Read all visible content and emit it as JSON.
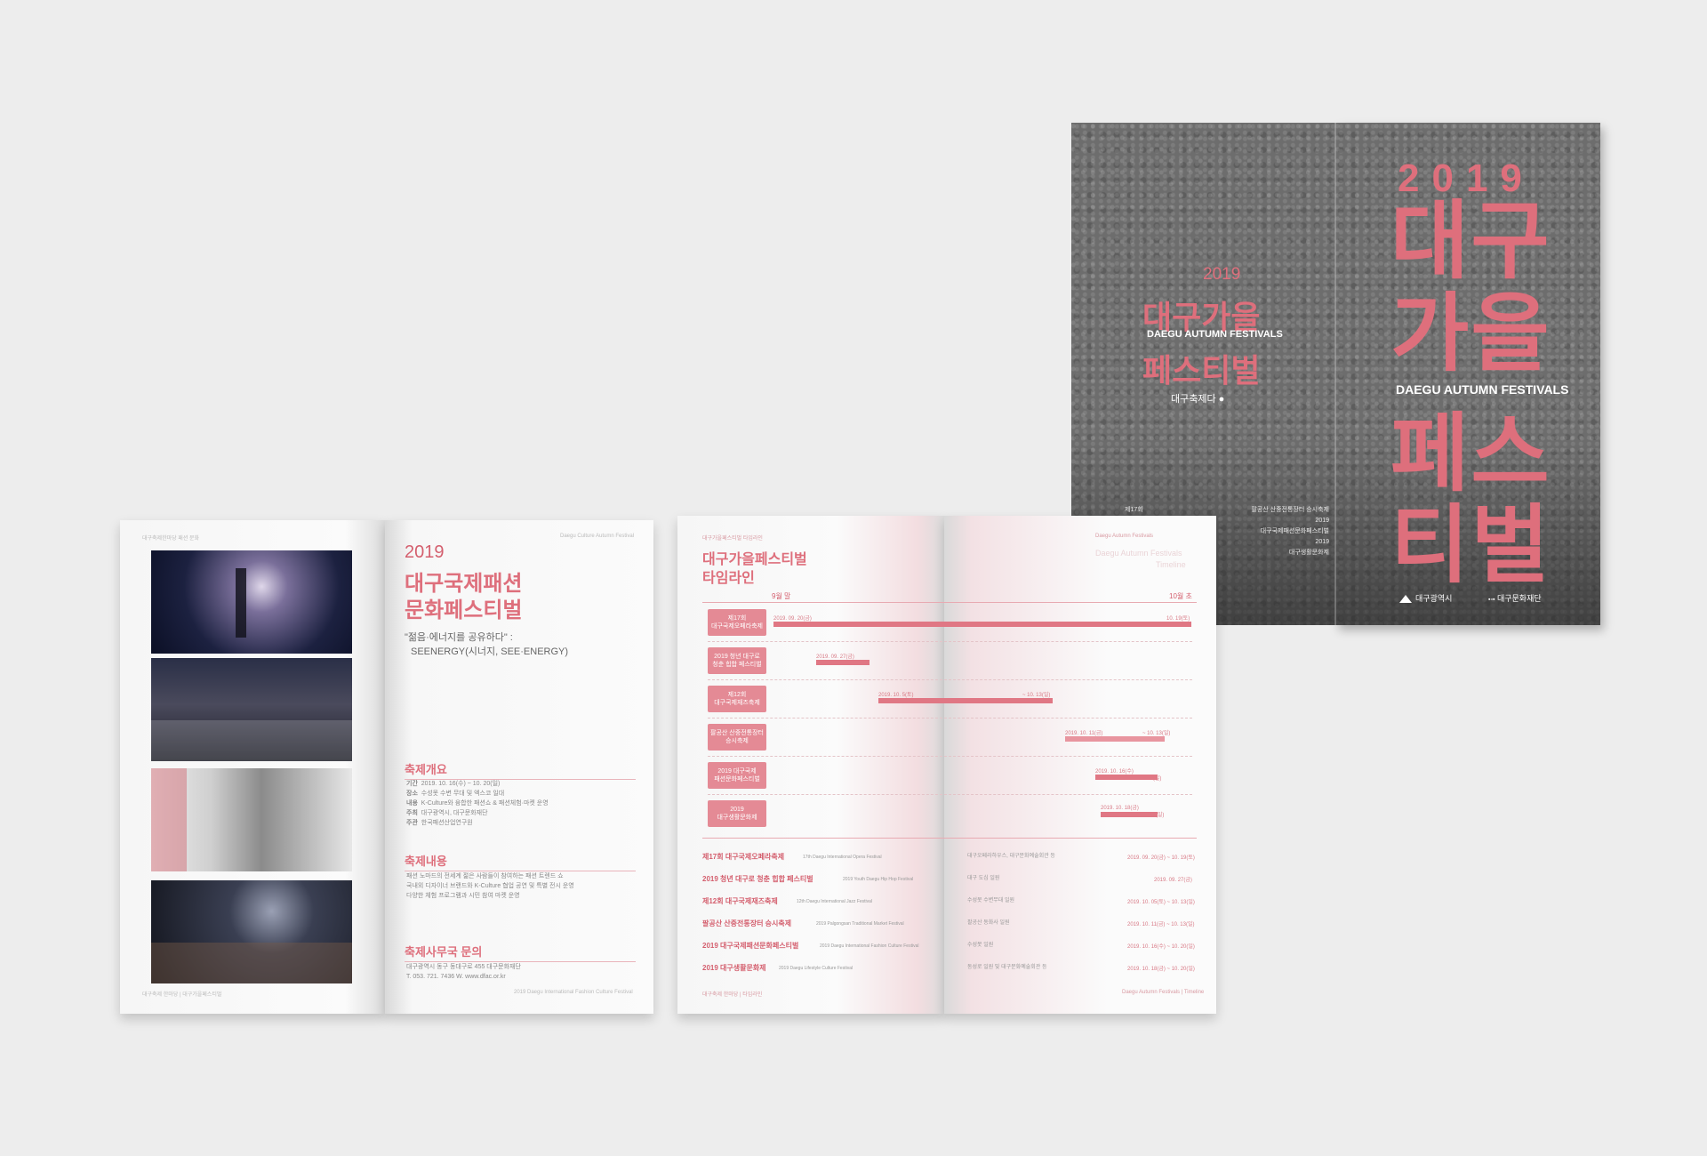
{
  "cover": {
    "front": {
      "year": "2019",
      "title_lines": [
        "대구",
        "가을",
        "페스",
        "티벌"
      ],
      "subtitle": "DAEGU AUTUMN FESTIVALS",
      "logo_city": "대구광역시",
      "logo_foundation": "대구문화재단"
    },
    "back": {
      "year": "2019",
      "title_line1": "대구가을",
      "title_line2": "페스티벌",
      "subtitle": "DAEGU AUTUMN FESTIVALS",
      "org": "대구축제다 ●",
      "list": [
        "제17회",
        "팔공산 산중전통장터 승시축제",
        "2019",
        "대구국제패션문화페스티벌",
        "2019",
        "대구생활문화제"
      ]
    }
  },
  "booklet1": {
    "left_header": "대구축제한마당 패션 문화",
    "right_header": "Daegu Culture Autumn Festival",
    "year": "2019",
    "title_line1": "대구국제패션",
    "title_line2": "문화페스티벌",
    "slogan": "\"젊음·에너지를 공유하다\" :",
    "slogan2": "SEENERGY(시너지, SEE·ENERGY)",
    "overview_title": "축제개요",
    "overview": [
      {
        "k": "기간",
        "v": "2019. 10. 16(수) ~ 10. 20(일)"
      },
      {
        "k": "장소",
        "v": "수성못 수변 무대 및 엑스코 일대"
      },
      {
        "k": "내용",
        "v": "K-Culture와 융합한 패션쇼 & 패션체험·마켓 운영"
      },
      {
        "k": "주최",
        "v": "대구광역시, 대구문화재단"
      },
      {
        "k": "주관",
        "v": "한국패션산업연구원"
      }
    ],
    "content_title": "축제내용",
    "content_lines": [
      "패션 노마드의 전세계 젊은 사람들이 참여하는 패션 트렌드 쇼",
      "국내외 디자이너 브랜드와 K-Culture 협업 공연 및 특별 전시 운영",
      "다양한 체험 프로그램과 시민 참여 마켓 운영"
    ],
    "office_title": "축제사무국 문의",
    "office_lines": [
      "대구광역시 동구 동대구로 455 대구문화재단",
      "T. 053. 721. 7436   W. www.dfac.or.kr"
    ],
    "footer_left": "대구축제 한마당 | 대구가을페스티벌",
    "footer_right": "2019 Daegu International Fashion Culture Festival"
  },
  "booklet2": {
    "left_header": "대구가을페스티벌 타임라인",
    "right_header": "Daegu Autumn Festivals",
    "title_line1": "대구가을페스티벌",
    "title_line2": "타임라인",
    "subtitle_en1": "Daegu Autumn Festivals",
    "subtitle_en2": "Timeline",
    "month_start": "9월 말",
    "month_end": "10월 초",
    "events": [
      {
        "label1": "제17회",
        "label2": "대구국제오페라축제",
        "date_start": "2019. 09. 20(금)",
        "date_end": "10. 19(토)"
      },
      {
        "label1": "2019 청년 대구로",
        "label2": "청춘 힙합 페스티벌",
        "date_start": "2019. 09. 27(금)",
        "date_end": ""
      },
      {
        "label1": "제12회",
        "label2": "대구국제재즈축제",
        "date_start": "2019. 10. 5(토)",
        "date_end": "~ 10. 13(일)"
      },
      {
        "label1": "팔공산 산중전통장터",
        "label2": "승시축제",
        "date_start": "2019. 10. 11(금)",
        "date_end": "~ 10. 13(일)"
      },
      {
        "label1": "2019 대구국제",
        "label2": "패션문화페스티벌",
        "date_start": "2019. 10. 16(수)",
        "date_end": "~ 10. 20(일)"
      },
      {
        "label1": "2019",
        "label2": "대구생활문화제",
        "date_start": "2019. 10. 18(금)",
        "date_end": "~ 10. 20(일)"
      }
    ],
    "list": [
      {
        "name": "제17회 대구국제오페라축제",
        "en": "17th Daegu International Opera Festival",
        "venue": "대구오페라하우스, 대구문화예술회관 등",
        "date": "2019. 09. 20(금) ~ 10. 19(토)"
      },
      {
        "name": "2019 청년 대구로 청춘 힙합 페스티벌",
        "en": "2019 Youth Daegu Hip Hop Festival",
        "venue": "대구 도심 일원",
        "date": "2019. 09. 27(금)"
      },
      {
        "name": "제12회 대구국제재즈축제",
        "en": "12th Daegu International Jazz Festival",
        "venue": "수성못 수변무대 일원",
        "date": "2019. 10. 05(토) ~ 10. 13(일)"
      },
      {
        "name": "팔공산 산중전통장터 승시축제",
        "en": "2019 Palgongsan Traditional Market Festival",
        "venue": "팔공산 동화사 일원",
        "date": "2019. 10. 11(금) ~ 10. 13(일)"
      },
      {
        "name": "2019 대구국제패션문화페스티벌",
        "en": "2019 Daegu International Fashion Culture Festival",
        "venue": "수성못 일원",
        "date": "2019. 10. 16(수) ~ 10. 20(일)"
      },
      {
        "name": "2019 대구생활문화제",
        "en": "2019 Daegu Lifestyle Culture Festival",
        "venue": "동성로 일원 및 대구문화예술회관 등",
        "date": "2019. 10. 18(금) ~ 10. 20(일)"
      }
    ],
    "footer_left": "대구축제 한마당 | 타임라인",
    "footer_right": "Daegu Autumn Festivals | Timeline"
  },
  "colors": {
    "accent": "#de6f7c",
    "cover_gray": "#6d6d6d",
    "background": "#ededed"
  }
}
